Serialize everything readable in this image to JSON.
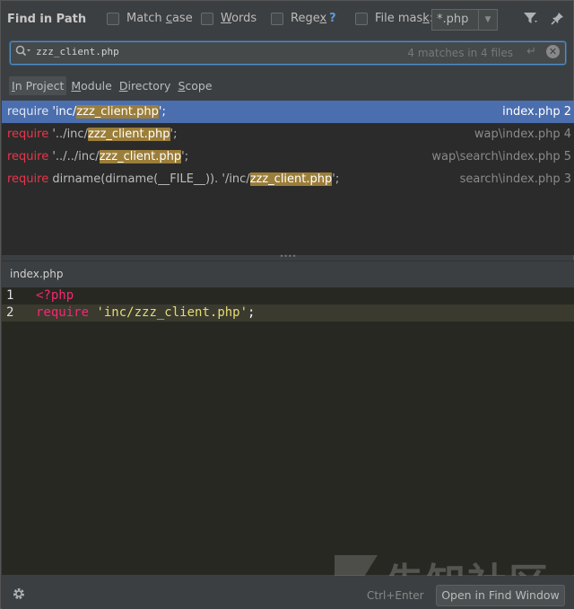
{
  "header": {
    "title": "Find in Path",
    "options": [
      {
        "label_prefix": "Match ",
        "label_key": "c",
        "label_suffix": "ase",
        "checked": false
      },
      {
        "label_prefix": "",
        "label_key": "W",
        "label_suffix": "ords",
        "checked": false
      },
      {
        "label_prefix": "Rege",
        "label_key": "x",
        "label_suffix": "",
        "checked": false,
        "help": "?"
      },
      {
        "label_prefix": "File mas",
        "label_key": "k",
        "label_suffix": ":",
        "checked": false
      }
    ],
    "file_mask_value": "*.php",
    "icons": [
      "filter-icon",
      "pin-icon"
    ]
  },
  "search": {
    "query": "zzz_client.php",
    "match_count": "4 matches in 4 files"
  },
  "scope_tabs": [
    {
      "prefix": "",
      "key": "I",
      "suffix": "n Project",
      "active": true
    },
    {
      "prefix": "",
      "key": "M",
      "suffix": "odule",
      "active": false
    },
    {
      "prefix": "",
      "key": "D",
      "suffix": "irectory",
      "active": false
    },
    {
      "prefix": "",
      "key": "S",
      "suffix": "cope",
      "active": false
    }
  ],
  "results": [
    {
      "pre_kw": "",
      "keyword": "require",
      "before": " 'inc/",
      "match": "zzz_client.php",
      "after": "';",
      "file": "index.php 2",
      "selected": true
    },
    {
      "pre_kw": "",
      "keyword": "require",
      "before": " '../inc/",
      "match": "zzz_client.php",
      "after": "';",
      "file": "wap\\index.php 4",
      "selected": false
    },
    {
      "pre_kw": "",
      "keyword": "require",
      "before": " '../../inc/",
      "match": "zzz_client.php",
      "after": "';",
      "file": "wap\\search\\index.php 5",
      "selected": false
    },
    {
      "pre_kw": "",
      "keyword": "require",
      "before": " dirname(dirname(__FILE__)). '/inc/",
      "match": "zzz_client.php",
      "after": "';",
      "file": "search\\index.php 3",
      "selected": false
    }
  ],
  "preview": {
    "title": "index.php",
    "lines": [
      {
        "num": "1",
        "tag": "<?php",
        "keyword": "",
        "string": "",
        "punc": ""
      },
      {
        "num": "2",
        "tag": "",
        "keyword": "require",
        "string": "'inc/zzz_client.php'",
        "punc": ";"
      }
    ]
  },
  "footer": {
    "shortcut": "Ctrl+Enter",
    "open_button": "Open in Find Window"
  },
  "watermark": "先知社区",
  "colors": {
    "selection": "#4b6eaf",
    "match_highlight": "#9b7e3a",
    "search_border": "#4f8fc9"
  }
}
